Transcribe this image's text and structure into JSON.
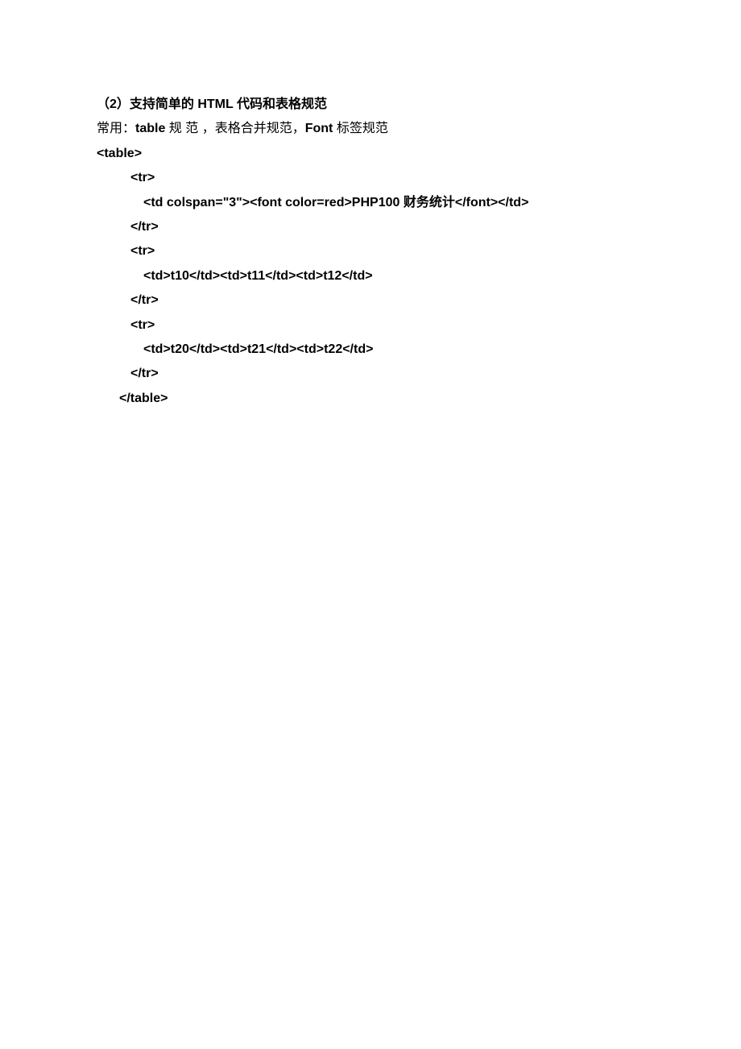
{
  "heading": {
    "prefix": "（2）",
    "text": "支持简单的 HTML 代码和表格规范"
  },
  "subheading": {
    "prefix": "常用：",
    "seg1": "table",
    "mid1": "  规 范 ，",
    "mid2": "表格合并规范，",
    "seg2": "Font",
    "suffix": " 标签规范"
  },
  "code": {
    "l1": "<table>",
    "l2": "<tr>",
    "l3": "<td colspan=\"3\"><font color=red>PHP100 财务统计</font></td>",
    "l4": "</tr>",
    "l5": "<tr>",
    "l6": "<td>t10</td><td>t11</td><td>t12</td>",
    "l7": "</tr>",
    "l8": "<tr>",
    "l9": "<td>t20</td><td>t21</td><td>t22</td>",
    "l10": "</tr>",
    "l11": "</table>"
  }
}
